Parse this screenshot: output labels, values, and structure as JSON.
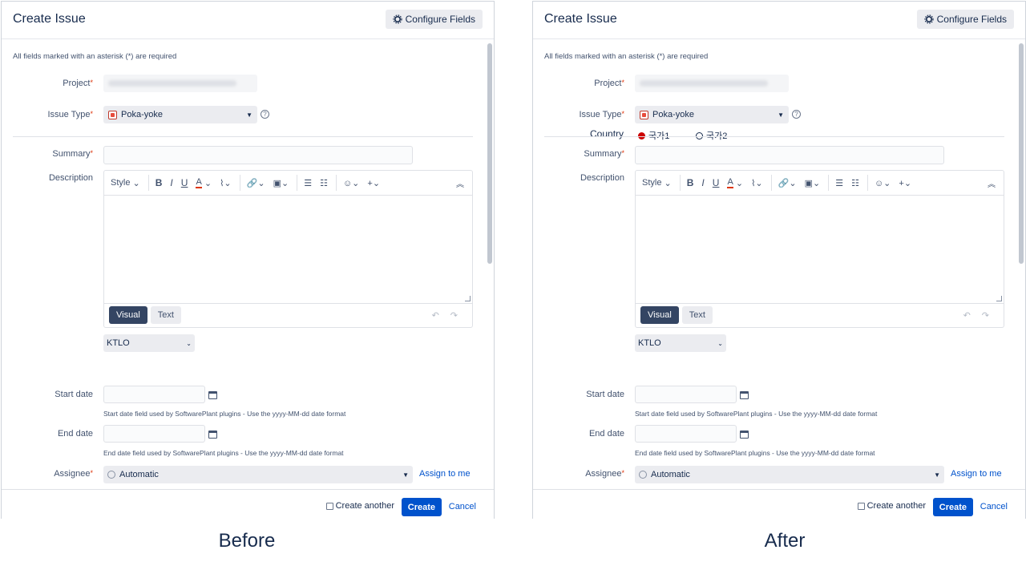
{
  "panels": {
    "before": {
      "title": "Create Issue",
      "configure_fields": "Configure Fields",
      "required_note": "All fields marked with an asterisk (*) are required",
      "project_label": "Project",
      "issue_type_label": "Issue Type",
      "issue_type_value": "Poka-yoke",
      "summary_label": "Summary",
      "description_label": "Description",
      "toolbar": {
        "style": "Style",
        "bold": "B",
        "italic": "I",
        "underline": "U",
        "color": "A"
      },
      "mode_visual": "Visual",
      "mode_text": "Text",
      "ktlo_value": "KTLO",
      "start_date_label": "Start date",
      "start_date_hint": "Start date field used by SoftwarePlant plugins - Use the yyyy-MM-dd date format",
      "end_date_label": "End date",
      "end_date_hint": "End date field used by SoftwarePlant plugins - Use the yyyy-MM-dd date format",
      "assignee_label": "Assignee",
      "assignee_value": "Automatic",
      "assign_to_me": "Assign to me",
      "create_another": "Create another",
      "create_button": "Create",
      "cancel_link": "Cancel",
      "caption": "Before"
    },
    "after": {
      "title": "Create Issue",
      "configure_fields": "Configure Fields",
      "required_note": "All fields marked with an asterisk (*) are required",
      "project_label": "Project",
      "issue_type_label": "Issue Type",
      "issue_type_value": "Poka-yoke",
      "country_label": "Country",
      "country_options": [
        "국가1",
        "국가2"
      ],
      "country_selected": "국가1",
      "summary_label": "Summary",
      "description_label": "Description",
      "toolbar": {
        "style": "Style",
        "bold": "B",
        "italic": "I",
        "underline": "U",
        "color": "A"
      },
      "mode_visual": "Visual",
      "mode_text": "Text",
      "ktlo_value": "KTLO",
      "start_date_label": "Start date",
      "start_date_hint": "Start date field used by SoftwarePlant plugins - Use the yyyy-MM-dd date format",
      "end_date_label": "End date",
      "end_date_hint": "End date field used by SoftwarePlant plugins - Use the yyyy-MM-dd date format",
      "assignee_label": "Assignee",
      "assignee_value": "Automatic",
      "assign_to_me": "Assign to me",
      "create_another": "Create another",
      "create_button": "Create",
      "cancel_link": "Cancel",
      "caption": "After"
    }
  },
  "colors": {
    "primary": "#0052cc",
    "visual_tab": "#344563",
    "required": "#de350b",
    "radio_selected": "#cc0000"
  },
  "icons": [
    "gear-icon",
    "issue-type-icon",
    "help-icon",
    "calendar-icon",
    "avatar-icon",
    "chevron-down-icon",
    "undo-icon",
    "redo-icon",
    "collapse-toolbar-icon"
  ]
}
